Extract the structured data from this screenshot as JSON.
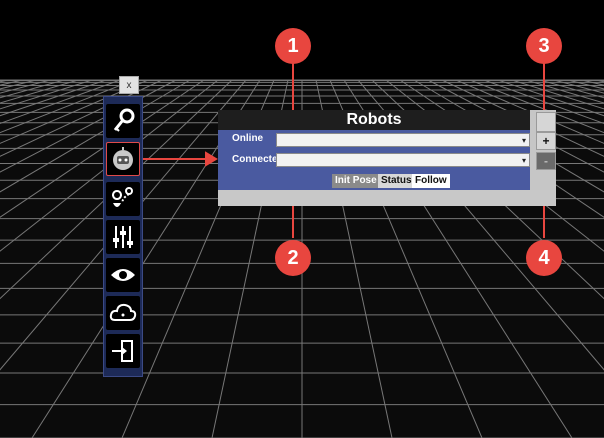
{
  "sidebar": {
    "close_label": "x",
    "items": [
      {
        "name": "key-icon"
      },
      {
        "name": "robot-icon",
        "active": true
      },
      {
        "name": "route-icon"
      },
      {
        "name": "sliders-icon"
      },
      {
        "name": "eye-icon"
      },
      {
        "name": "cloud-icon"
      },
      {
        "name": "exit-icon"
      }
    ]
  },
  "panel": {
    "title": "Robots",
    "online_label": "Online",
    "connected_label": "Connecte",
    "add_label": "+",
    "remove_label": "-",
    "combo_arrow": "▾",
    "tabs": [
      "Init Pose",
      "Status",
      "Follow"
    ]
  },
  "callouts": [
    "1",
    "2",
    "3",
    "4"
  ],
  "colors": {
    "callout": "#e8463f",
    "panel_body": "#4a5aa0",
    "grid": "#9a9a9a"
  }
}
